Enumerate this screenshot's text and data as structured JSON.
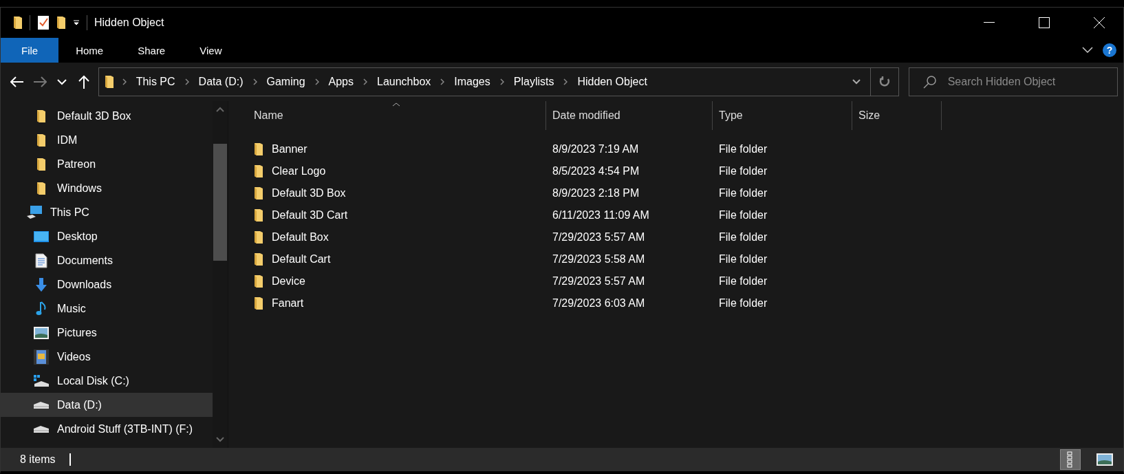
{
  "window": {
    "title": "Hidden Object"
  },
  "ribbon_tabs": [
    {
      "label": "File",
      "selected": true
    },
    {
      "label": "Home",
      "selected": false
    },
    {
      "label": "Share",
      "selected": false
    },
    {
      "label": "View",
      "selected": false
    }
  ],
  "help_button": {
    "label": "?"
  },
  "address_bar": {
    "path": [
      "This PC",
      "Data (D:)",
      "Gaming",
      "Apps",
      "Launchbox",
      "Images",
      "Playlists",
      "Hidden Object"
    ]
  },
  "search": {
    "placeholder": "Search Hidden Object"
  },
  "sidebar": {
    "items": [
      {
        "label": "Default 3D Box",
        "kind": "folder",
        "selected": false
      },
      {
        "label": "IDM",
        "kind": "folder",
        "selected": false
      },
      {
        "label": "Patreon",
        "kind": "folder",
        "selected": false
      },
      {
        "label": "Windows",
        "kind": "folder",
        "selected": false
      },
      {
        "label": "This PC",
        "kind": "pc",
        "selected": false,
        "children": [
          {
            "label": "Desktop",
            "kind": "desktop",
            "selected": false
          },
          {
            "label": "Documents",
            "kind": "documents",
            "selected": false
          },
          {
            "label": "Downloads",
            "kind": "downloads",
            "selected": false
          },
          {
            "label": "Music",
            "kind": "music",
            "selected": false
          },
          {
            "label": "Pictures",
            "kind": "pictures",
            "selected": false
          },
          {
            "label": "Videos",
            "kind": "videos",
            "selected": false
          },
          {
            "label": "Local Disk (C:)",
            "kind": "system-disk",
            "selected": false
          },
          {
            "label": "Data (D:)",
            "kind": "disk",
            "selected": true
          },
          {
            "label": "Android Stuff (3TB-INT) (F:)",
            "kind": "disk",
            "selected": false
          }
        ]
      }
    ]
  },
  "table": {
    "columns": [
      "Name",
      "Date modified",
      "Type",
      "Size"
    ],
    "rows": [
      {
        "name": "Banner",
        "date": "8/9/2023 7:19 AM",
        "type": "File folder"
      },
      {
        "name": "Clear Logo",
        "date": "8/5/2023 4:54 PM",
        "type": "File folder"
      },
      {
        "name": "Default 3D Box",
        "date": "8/9/2023 2:18 PM",
        "type": "File folder"
      },
      {
        "name": "Default 3D Cart",
        "date": "6/11/2023 11:09 AM",
        "type": "File folder"
      },
      {
        "name": "Default Box",
        "date": "7/29/2023 5:57 AM",
        "type": "File folder"
      },
      {
        "name": "Default Cart",
        "date": "7/29/2023 5:58 AM",
        "type": "File folder"
      },
      {
        "name": "Device",
        "date": "7/29/2023 5:57 AM",
        "type": "File folder"
      },
      {
        "name": "Fanart",
        "date": "7/29/2023 6:03 AM",
        "type": "File folder"
      }
    ]
  },
  "status_bar": {
    "item_count": "8 items"
  }
}
